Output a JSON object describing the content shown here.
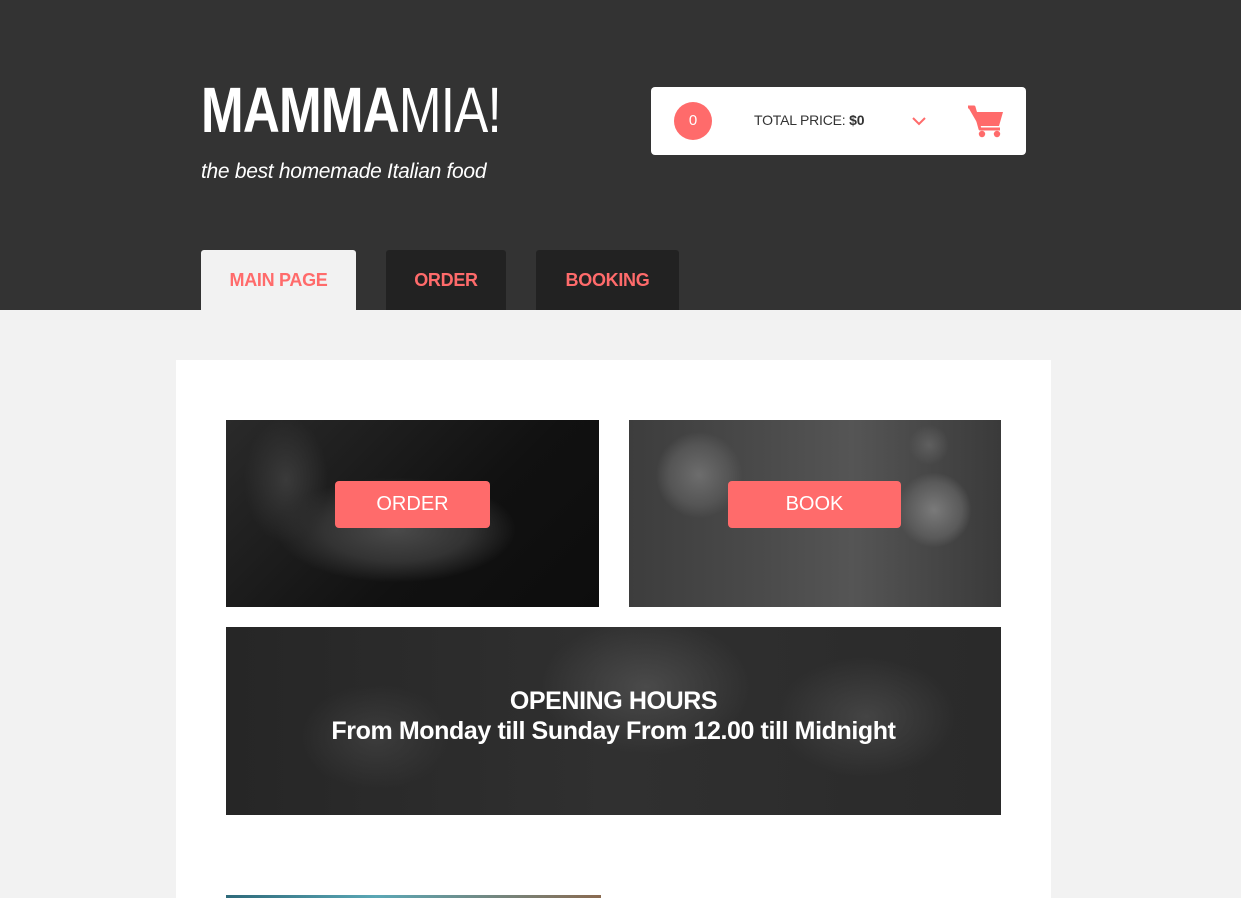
{
  "brand": {
    "logo_bold": "MAMMA",
    "logo_light": "MIA!",
    "tagline": "the best homemade Italian food"
  },
  "cart": {
    "count": "0",
    "total_label": "TOTAL PRICE: ",
    "total_amount": "$0",
    "chevron_icon": "chevron-down-icon",
    "cart_icon": "shopping-cart-icon"
  },
  "nav": {
    "tabs": [
      {
        "label": "MAIN PAGE",
        "active": true
      },
      {
        "label": "ORDER",
        "active": false
      },
      {
        "label": "BOOKING",
        "active": false
      }
    ]
  },
  "tiles": {
    "order_button": "ORDER",
    "book_button": "BOOK",
    "hours_title": "OPENING HOURS",
    "hours_text": "From Monday till Sunday From 12.00 till Midnight"
  },
  "colors": {
    "accent": "#ff6b6b",
    "header_bg": "#333333",
    "tab_inactive_bg": "#222222",
    "page_bg": "#f2f2f2"
  }
}
